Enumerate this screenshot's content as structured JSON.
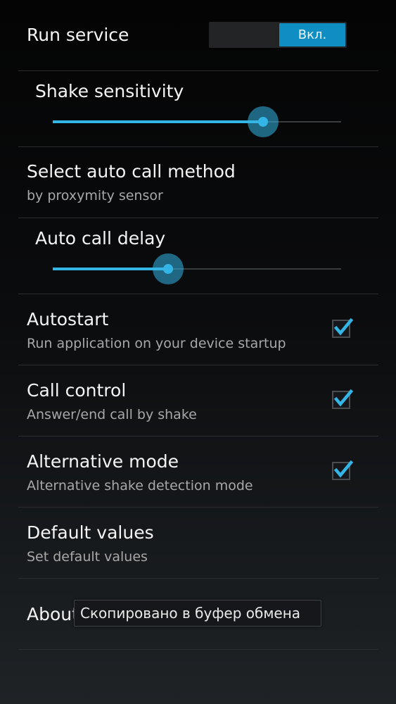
{
  "settings": {
    "run_service": {
      "title": "Run service",
      "switch_label": "Вкл.",
      "on": true
    },
    "shake_sensitivity": {
      "title": "Shake sensitivity",
      "value_fraction": 0.73
    },
    "auto_call_method": {
      "title": "Select auto call method",
      "summary": "by proxymity sensor"
    },
    "auto_call_delay": {
      "title": "Auto call delay",
      "value_fraction": 0.4
    },
    "autostart": {
      "title": "Autostart",
      "summary": "Run application on your device startup",
      "checked": true
    },
    "call_control": {
      "title": "Call control",
      "summary": "Answer/end call by shake",
      "checked": true
    },
    "alternative_mode": {
      "title": "Alternative mode",
      "summary": "Alternative shake detection mode",
      "checked": true
    },
    "default_values": {
      "title": "Default values",
      "summary": "Set default values"
    },
    "about": {
      "title": "About"
    }
  },
  "toast": {
    "text": "Скопировано в буфер обмена"
  },
  "colors": {
    "accent": "#33b5e5",
    "switch_on": "#0f8ec3",
    "background": "#000000"
  },
  "icons": {
    "check": "check-icon"
  }
}
